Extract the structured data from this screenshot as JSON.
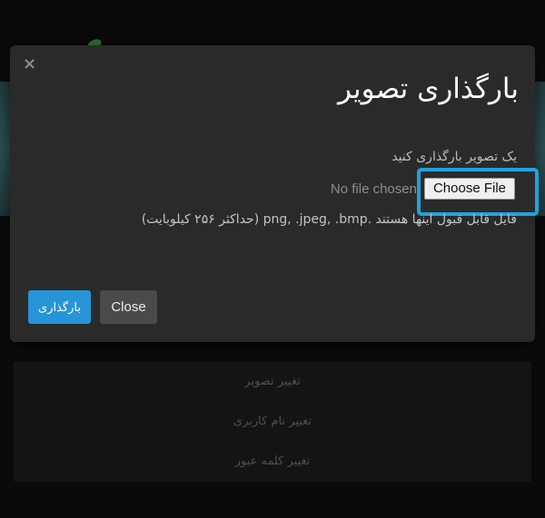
{
  "background": {
    "menu_items": [
      "تغییر تصویر",
      "تغییر نام کاربری",
      "تغییر کلمه عبور"
    ]
  },
  "modal": {
    "close_icon": "×",
    "title": "بارگذاری تصویر",
    "label": "یک تصویر بارگذاری کنید",
    "file_input": {
      "button_label": "Choose File",
      "status": "No file chosen"
    },
    "help_text": "فایل قابل قبول اینها هستند .png, .jpeg, .bmp (حداکثر ۲۵۶ کیلوبایت)",
    "upload_button": "بارگذاری",
    "close_button": "Close"
  },
  "colors": {
    "primary": "#2794d8",
    "highlight": "#1fa3dc",
    "modal_bg": "#2a2a2a"
  }
}
